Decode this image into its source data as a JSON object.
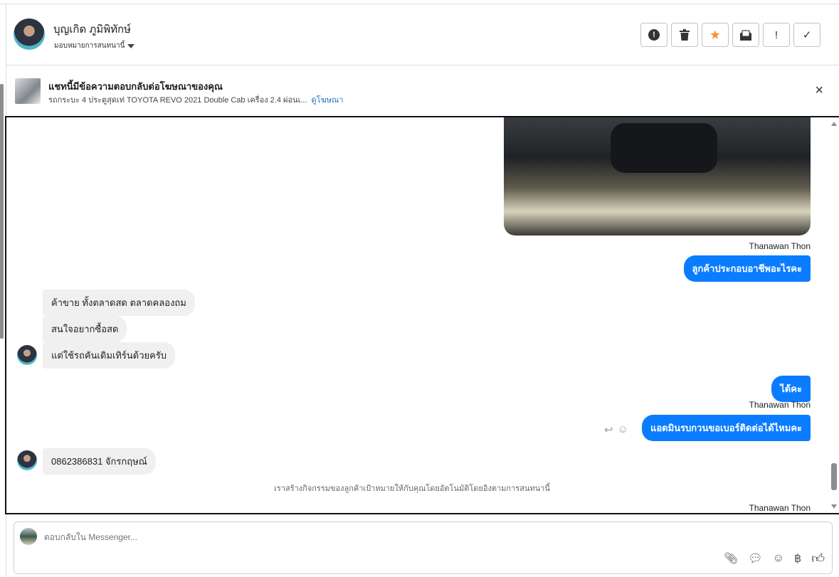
{
  "header": {
    "name": "บุญเกิด ภูมิพิทักษ์",
    "assign_label": "มอบหมายการสนทนานี้",
    "actions": [
      {
        "icon": "exclamation-circle-icon",
        "glyph": "●"
      },
      {
        "icon": "trash-icon",
        "glyph": "🗑"
      },
      {
        "icon": "star-icon",
        "glyph": "★",
        "color": "#f5922f"
      },
      {
        "icon": "mail-open-icon",
        "glyph": "✉"
      },
      {
        "icon": "exclamation-icon",
        "glyph": "!"
      },
      {
        "icon": "check-icon",
        "glyph": "✓"
      }
    ]
  },
  "ad": {
    "title": "แชทนี้มีข้อความตอบกลับต่อโฆษณาของคุณ",
    "subtitle": "รถกระบะ 4 ประตูสุดเท่ TOYOTA REVO 2021 Double Cab เครื่อง 2.4 ผ่อนเ...",
    "link": "ดูโฆษณา",
    "close": "×"
  },
  "messages": {
    "sender_name": "Thanawan Thon",
    "out1": "ลูกค้าประกอบอาชีพอะไรคะ",
    "in1": "ค้าขาย ทั้งตลาดสด ตลาดคลองถม",
    "in2": "สนใจอยากซื้อสด",
    "in3": "แต่ใช้รถคันเดิมเทิร์นด้วยครับ",
    "out2": "ได้คะ",
    "out3": "แอดมินรบกวนขอเบอร์ติดต่อได้ไหมคะ",
    "in4": "0862386831 จักรกฤษณ์",
    "system": "เราสร้างกิจกรรมของลูกค้าเป้าหมายให้กับคุณโดยอัตโนมัติโดยอิงตามการสนทนานี้"
  },
  "composer": {
    "placeholder": "ตอบกลับใน Messenger...",
    "icons": [
      "paperclip-icon",
      "chat-bubble-icon",
      "emoji-icon",
      "baht-icon",
      "thumbs-up-icon"
    ]
  },
  "colors": {
    "outgoing_bubble": "#0a7cff",
    "incoming_bubble": "#f0f0f0",
    "link": "#1f6fb5"
  }
}
